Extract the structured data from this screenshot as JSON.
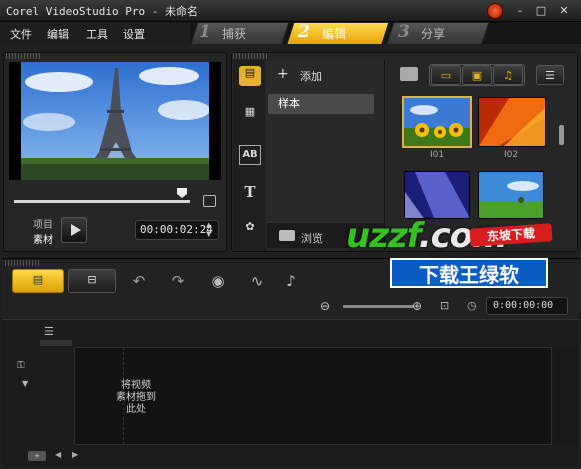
{
  "window": {
    "title": "Corel VideoStudio Pro - 未命名",
    "minimize": "–",
    "maximize": "□",
    "close": "✕"
  },
  "menu": [
    "文件",
    "编辑",
    "工具",
    "设置"
  ],
  "steps": [
    {
      "num": "1",
      "label": "捕获"
    },
    {
      "num": "2",
      "label": "编辑"
    },
    {
      "num": "3",
      "label": "分享"
    }
  ],
  "player": {
    "mode_project": "项目",
    "mode_clip": "素材",
    "timecode": "00:00:02:24"
  },
  "library": {
    "add_label": "添加",
    "folder_item": "样本",
    "browse_label": "浏览",
    "thumbs": [
      {
        "caption": "I01"
      },
      {
        "caption": "I02"
      },
      {
        "caption": ""
      },
      {
        "caption": ""
      }
    ]
  },
  "timeline": {
    "timecode": "0:00:00:00",
    "placeholder": "将视频\n素材拖到\n此处"
  },
  "watermark": {
    "site_green": "uzzf",
    "site_white": ".com",
    "badge": "东坡下载",
    "text": "下载王绿软"
  },
  "colors": {
    "accent": "#f5c016",
    "panel": "#262626",
    "background": "#202020"
  }
}
